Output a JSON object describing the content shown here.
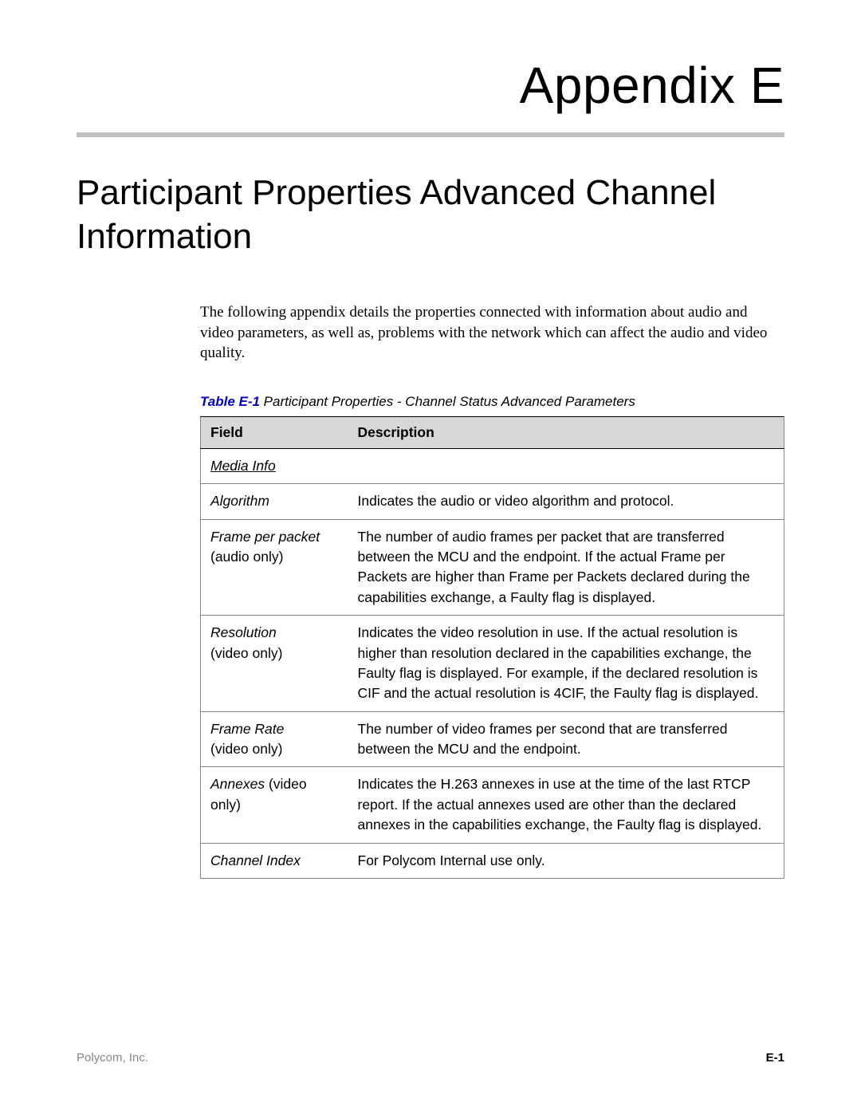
{
  "header": {
    "appendix": "Appendix E",
    "section_title": "Participant Properties Advanced Channel Information"
  },
  "intro": "The following appendix details the properties connected with information about audio and video parameters, as well as, problems with the network which can affect the audio and video quality.",
  "table": {
    "caption_label": "Table E-1",
    "caption_text": " Participant Properties - Channel Status Advanced Parameters",
    "col_field": "Field",
    "col_desc": "Description",
    "section_heading": "Media Info",
    "rows": [
      {
        "field": "Algorithm",
        "qual": "",
        "desc": "Indicates the audio or video algorithm and protocol."
      },
      {
        "field": "Frame per packet",
        "qual": " (audio only)",
        "desc": "The number of audio frames per packet that are transferred between the MCU and the endpoint. If the actual Frame per Packets are higher than Frame per Packets declared during the capabilities exchange, a Faulty flag is displayed."
      },
      {
        "field": "Resolution",
        "qual": " (video only)",
        "desc": "Indicates the video resolution in use. If the actual resolution is higher than resolution declared in the capabilities exchange, the Faulty flag is displayed. For example, if the declared resolution is CIF and the actual resolution is 4CIF, the Faulty flag is displayed."
      },
      {
        "field": "Frame Rate",
        "qual": " (video only)",
        "desc": "The number of video frames per second that are transferred between the MCU and the endpoint."
      },
      {
        "field": "Annexes",
        "qual": " (video only)",
        "desc": "Indicates the H.263 annexes in use at the time of the last RTCP report. If the actual annexes used are other than the declared annexes in the capabilities exchange, the Faulty flag is displayed."
      },
      {
        "field": "Channel Index",
        "qual": "",
        "desc": "For Polycom Internal use only."
      }
    ]
  },
  "footer": {
    "company": "Polycom, Inc.",
    "page": "E-1"
  }
}
